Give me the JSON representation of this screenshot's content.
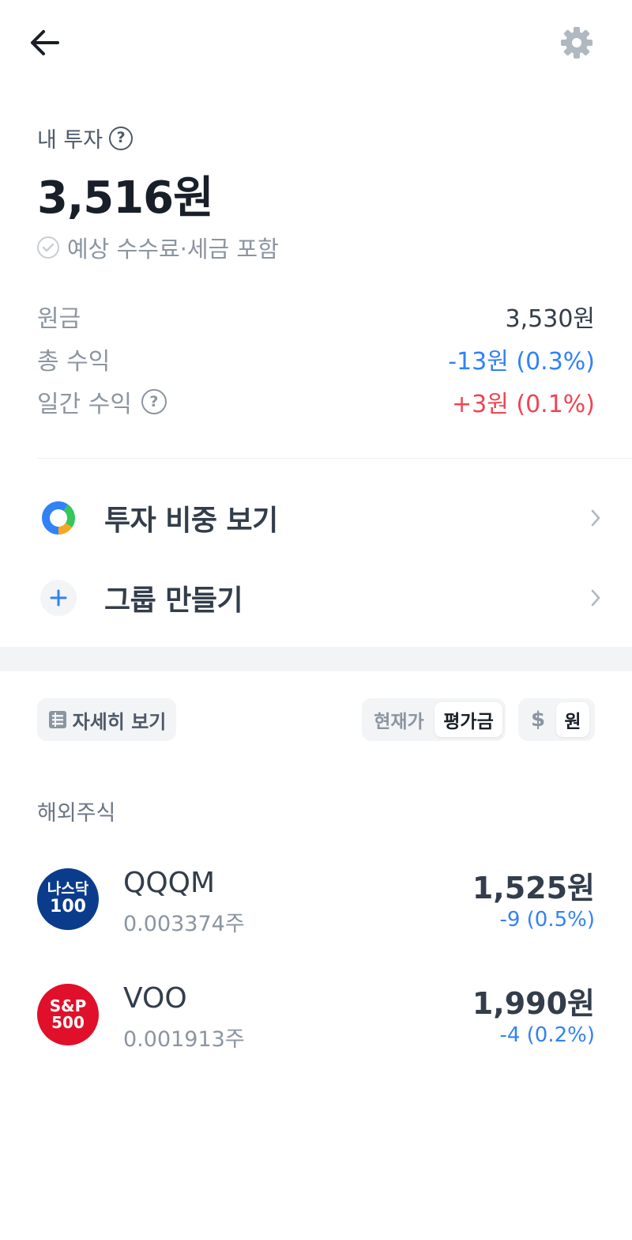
{
  "header": {
    "back_icon": "arrow-left-icon",
    "settings_icon": "gear-icon"
  },
  "summary": {
    "title": "내 투자",
    "help_mark": "?",
    "total": "3,516원",
    "fee_note": "예상 수수료·세금 포함",
    "rows": [
      {
        "label": "원금",
        "value": "3,530원"
      },
      {
        "label": "총 수익",
        "value": "-13원 (0.3%)"
      },
      {
        "label": "일간 수익",
        "value": "+3원 (0.1%)"
      }
    ]
  },
  "menu": [
    {
      "label": "투자 비중 보기",
      "icon": "pie-chart-icon"
    },
    {
      "label": "그룹 만들기",
      "icon": "plus-icon"
    }
  ],
  "toolbar": {
    "detail_label": "자세히 보기",
    "price_toggle": [
      "현재가",
      "평가금"
    ],
    "price_selected": "평가금",
    "currency_toggle": [
      "$",
      "원"
    ],
    "currency_selected": "원"
  },
  "section": {
    "title": "해외주식"
  },
  "holdings": [
    {
      "logo_lines": [
        "나스닥",
        "100"
      ],
      "name": "QQQM",
      "quantity": "0.003374주",
      "amount": "1,525원",
      "change": "-9 (0.5%)"
    },
    {
      "logo_lines": [
        "S&P",
        "500"
      ],
      "name": "VOO",
      "quantity": "0.001913주",
      "amount": "1,990원",
      "change": "-4 (0.2%)"
    }
  ],
  "colors": {
    "text_primary": "#191f28",
    "text_secondary": "#8b95a1",
    "negative_blue": "#3182f6",
    "positive_red": "#f04452",
    "nasdaq_logo": "#0b3c8c",
    "sp_logo": "#e0102a"
  }
}
